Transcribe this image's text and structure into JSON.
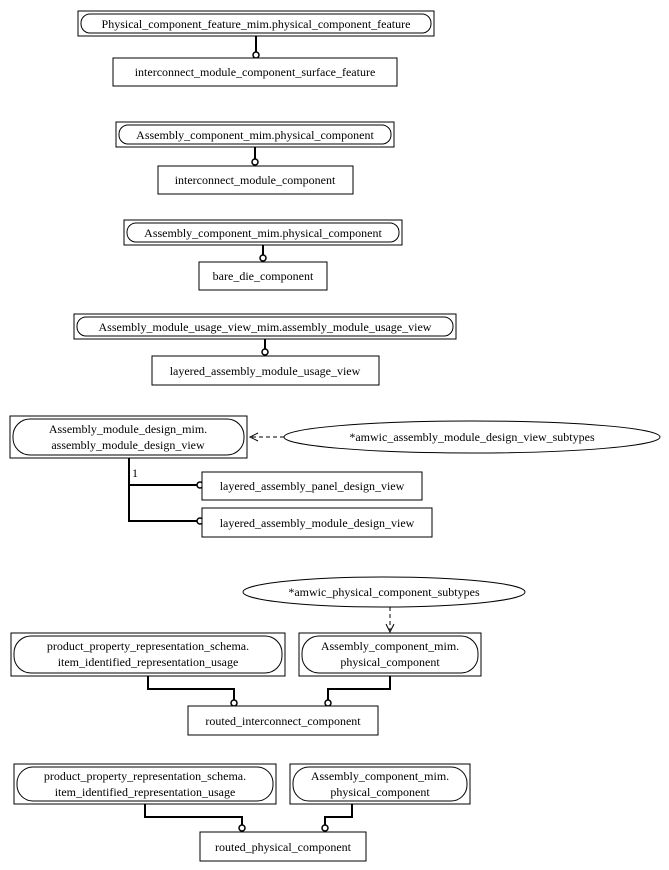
{
  "diagram": {
    "type": "EXPRESS-G",
    "groups": [
      {
        "id": "g1",
        "supertype": "Physical_component_feature_mim.physical_component_feature",
        "subtypes": [
          "interconnect_module_component_surface_feature"
        ]
      },
      {
        "id": "g2",
        "supertype": "Assembly_component_mim.physical_component",
        "subtypes": [
          "interconnect_module_component"
        ]
      },
      {
        "id": "g3",
        "supertype": "Assembly_component_mim.physical_component",
        "subtypes": [
          "bare_die_component"
        ]
      },
      {
        "id": "g4",
        "supertype": "Assembly_module_usage_view_mim.assembly_module_usage_view",
        "subtypes": [
          "layered_assembly_module_usage_view"
        ]
      },
      {
        "id": "g5",
        "supertype_lines": [
          "Assembly_module_design_mim.",
          "assembly_module_design_view"
        ],
        "subtype_reference": "*amwic_assembly_module_design_view_subtypes",
        "cardinality_label": "1",
        "subtypes": [
          "layered_assembly_panel_design_view",
          "layered_assembly_module_design_view"
        ]
      },
      {
        "id": "g6",
        "subtype_reference": "*amwic_physical_component_subtypes",
        "supertypes": [
          {
            "lines": [
              "product_property_representation_schema.",
              "item_identified_representation_usage"
            ]
          },
          {
            "lines": [
              "Assembly_component_mim.",
              "physical_component"
            ]
          }
        ],
        "subtype": "routed_interconnect_component"
      },
      {
        "id": "g7",
        "supertypes": [
          {
            "lines": [
              "product_property_representation_schema.",
              "item_identified_representation_usage"
            ]
          },
          {
            "lines": [
              "Assembly_component_mim.",
              "physical_component"
            ]
          }
        ],
        "subtype": "routed_physical_component"
      }
    ]
  }
}
